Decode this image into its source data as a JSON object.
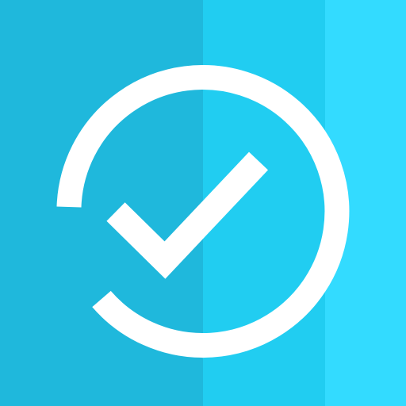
{
  "icon": {
    "name": "task-complete-icon",
    "symbol": "check-circle-icon",
    "colors": {
      "band_left": "#1fb8dc",
      "band_middle": "#21cdf1",
      "band_right": "#33dbff",
      "glyph": "#ffffff"
    }
  }
}
